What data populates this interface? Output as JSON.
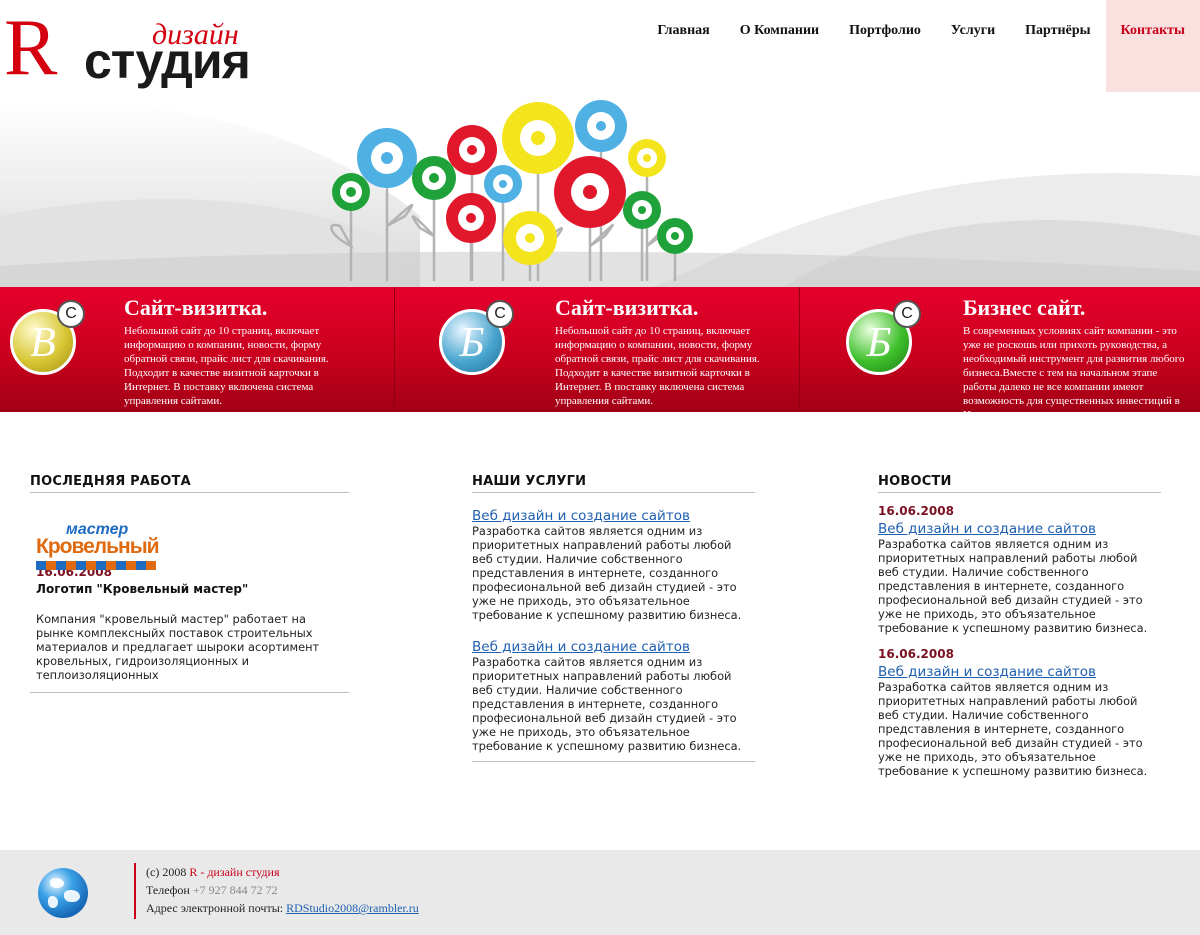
{
  "logo": {
    "letter": "R",
    "studio": "студия",
    "design": "дизайн"
  },
  "nav": [
    {
      "label": "Главная"
    },
    {
      "label": "О Компании"
    },
    {
      "label": "Портфолио"
    },
    {
      "label": "Услуги"
    },
    {
      "label": "Партнёры"
    },
    {
      "label": "Контакты",
      "active": true
    }
  ],
  "promos": [
    {
      "title": "Сайт-визитка.",
      "badge_letter": "В",
      "badge_extra": "С",
      "color": "#d8c734",
      "text": "Небольшой сайт до 10 страниц, включает информацию о компании, новости, форму обратной связи, прайс лист для скачивания. Подходит в качестве визитной карточки в Интернет. В поставку включена система управления сайтами."
    },
    {
      "title": "Сайт-визитка.",
      "badge_letter": "Б",
      "badge_extra": "С",
      "color": "#4aa6cf",
      "text": "Небольшой сайт до 10 страниц, включает информацию о компании, новости, форму обратной связи, прайс лист для скачивания. Подходит в качестве визитной карточки в Интернет. В поставку включена система управления сайтами."
    },
    {
      "title": "Бизнес сайт.",
      "badge_letter": "Б",
      "badge_extra": "С",
      "color": "#3fbf2c",
      "text": "В современных условиях сайт компании - это уже не роскошь или прихоть руководства, а необходимый инструмент для развития любого бизнеса.Вместе с тем на начальном этапе работы далеко не все компании имеют возможность для существенных инвестиций в И..."
    }
  ],
  "last_work": {
    "heading": "ПОСЛЕДНЯЯ РАБОТА",
    "logo_top": "мастер",
    "logo_main": "Кровельный",
    "date": "16.06.2008",
    "title": "Логотип \"Кровельный мастер\"",
    "text": "Компания \"кровельный мастер\" работает на рынке комплексныйх поставок строительных материалов и предлагает шыроки асортимент кровельных, гидроизоляционных и теплоизоляционных"
  },
  "services": {
    "heading": "НАШИ УСЛУГИ",
    "items": [
      {
        "title": "Веб дизайн и создание сайтов",
        "text": "Разработка сайтов является одним из приоритетных направлений работы любой веб студии. Наличие собственного представления в интернете, созданного професиональной веб дизайн студией - это уже не приходь, это объязательное требование к успешному развитию бизнеса."
      },
      {
        "title": "Веб дизайн и создание сайтов",
        "text": "Разработка сайтов является одним из приоритетных направлений работы любой веб студии. Наличие собственного представления в интернете, созданного професиональной веб дизайн студией - это уже не приходь, это объязательное требование к успешному развитию бизнеса."
      }
    ]
  },
  "news": {
    "heading": "НОВОСТИ",
    "items": [
      {
        "date": "16.06.2008",
        "title": "Веб дизайн и создание сайтов",
        "text": "Разработка сайтов является одним из приоритетных направлений работы любой веб студии. Наличие собственного представления в интернете, созданного професиональной веб дизайн студией - это уже не приходь, это объязательное требование к успешному развитию бизнеса."
      },
      {
        "date": "16.06.2008",
        "title": "Веб дизайн и создание сайтов",
        "text": "Разработка сайтов является одним из приоритетных направлений работы любой веб студии. Наличие собственного представления в интернете, созданного професиональной веб дизайн студией - это уже не приходь, это объязательное требование к успешному развитию бизнеса."
      }
    ]
  },
  "footer": {
    "copyright": "(c) 2008",
    "studio": "R - дизайн студия",
    "phone_label": "Телефон",
    "phone": "+7 927 844 72 72",
    "email_label": "Адрес электронной почты:",
    "email": "RDStudio2008@rambler.ru"
  },
  "colors": {
    "accent": "#c8001a",
    "link": "#1f5fb0",
    "date": "#7a1020"
  }
}
